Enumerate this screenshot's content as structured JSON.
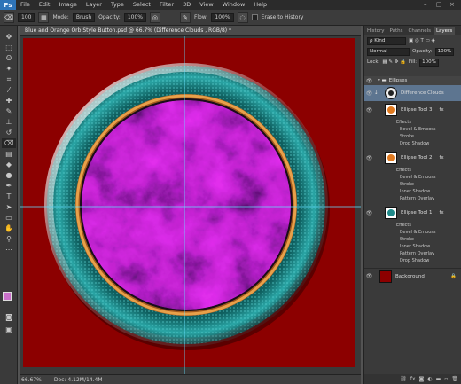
{
  "app": {
    "logo": "Ps"
  },
  "menu": {
    "items": [
      "File",
      "Edit",
      "Image",
      "Layer",
      "Type",
      "Select",
      "Filter",
      "3D",
      "View",
      "Window",
      "Help"
    ],
    "window_controls": [
      "–",
      "□",
      "×"
    ]
  },
  "options": {
    "brush_size": "100",
    "mode_label": "Mode:",
    "mode_value": "Brush",
    "opacity_label": "Opacity:",
    "opacity_value": "100%",
    "flow_label": "Flow:",
    "flow_value": "100%",
    "erase_history_label": "Erase to History"
  },
  "document": {
    "tab_title": "Blue and Orange Orb Style Button.psd @ 66.7% (Difference Clouds , RGB/8) *",
    "zoom": "66.67%",
    "doc_size": "Doc: 4.12M/14.4M",
    "canvas_color": "#8c0000"
  },
  "colors": {
    "foreground": "#c970c9",
    "background": "#ffffff",
    "teal": "#1f8a8a",
    "orange": "#d98a3a"
  },
  "panel": {
    "tabs": [
      "History",
      "Paths",
      "Channels",
      "Layers"
    ],
    "active_tab": "Layers",
    "filter_kind": "Kind",
    "blend_mode": "Normal",
    "opacity_label": "Opacity:",
    "opacity_value": "100%",
    "lock_label": "Lock:",
    "fill_label": "Fill:",
    "fill_value": "100%"
  },
  "layers": {
    "group_name": "Ellipses",
    "difference_clouds": "Difference Clouds",
    "e3": {
      "name": "Ellipse Tool 3",
      "fx": "fx",
      "effects_label": "Effects",
      "effects": [
        "Bevel & Emboss",
        "Stroke",
        "Drop Shadow"
      ]
    },
    "e2": {
      "name": "Ellipse Tool 2",
      "fx": "fx",
      "effects_label": "Effects",
      "effects": [
        "Bevel & Emboss",
        "Stroke",
        "Inner Shadow",
        "Pattern Overlay"
      ]
    },
    "e1": {
      "name": "Ellipse Tool 1",
      "fx": "fx",
      "effects_label": "Effects",
      "effects": [
        "Bevel & Emboss",
        "Stroke",
        "Inner Shadow",
        "Pattern Overlay",
        "Drop Shadow"
      ]
    },
    "background": "Background"
  }
}
